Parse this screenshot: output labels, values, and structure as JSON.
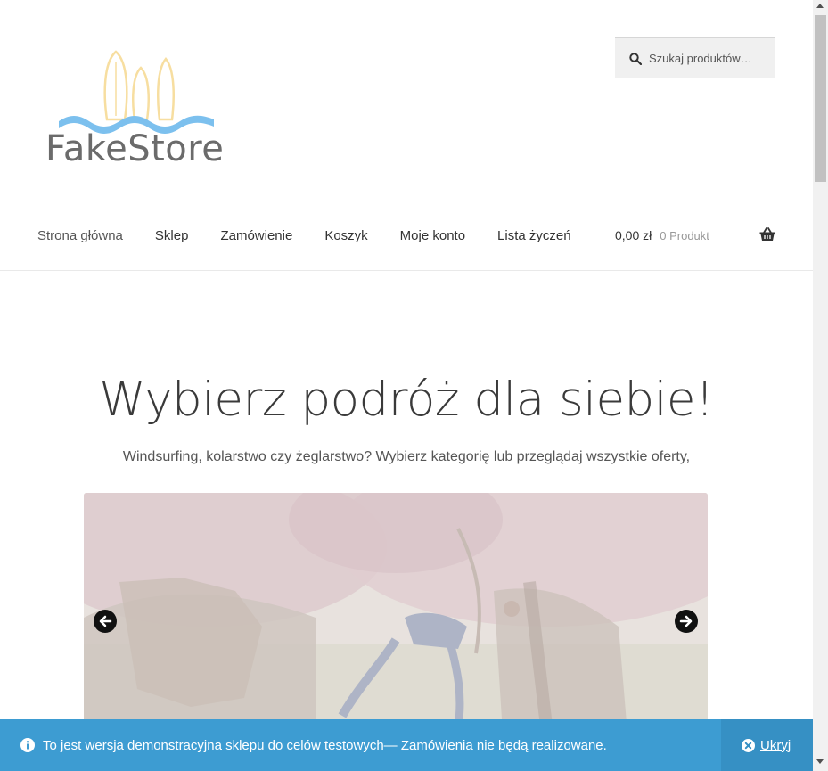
{
  "header": {
    "logo_text": "FakeStore",
    "search_placeholder": "Szukaj produktów…"
  },
  "nav": {
    "items": [
      {
        "label": "Strona główna"
      },
      {
        "label": "Sklep"
      },
      {
        "label": "Zamówienie"
      },
      {
        "label": "Koszyk"
      },
      {
        "label": "Moje konto"
      },
      {
        "label": "Lista życzeń"
      }
    ]
  },
  "cart": {
    "amount": "0,00 zł",
    "count": "0 Produkt",
    "icon": "basket-icon"
  },
  "hero": {
    "title": "Wybierz podróż dla siebie!",
    "subtitle": "Windsurfing, kolarstwo czy żeglarstwo? Wybierz kategorię lub przeglądaj wszystkie oferty,"
  },
  "slider": {
    "prev_icon": "arrow-left-icon",
    "next_icon": "arrow-right-icon"
  },
  "notice": {
    "text": "To jest wersja demonstracyjna sklepu do celów testowych— Zamówienia nie będą realizowane.",
    "dismiss_label": "Ukryj"
  },
  "colors": {
    "notice_bg": "#3d9cd2",
    "dismiss_bg": "#3690c4",
    "logo_wave": "#7cc0ee",
    "logo_boards": "#f7dea0"
  }
}
